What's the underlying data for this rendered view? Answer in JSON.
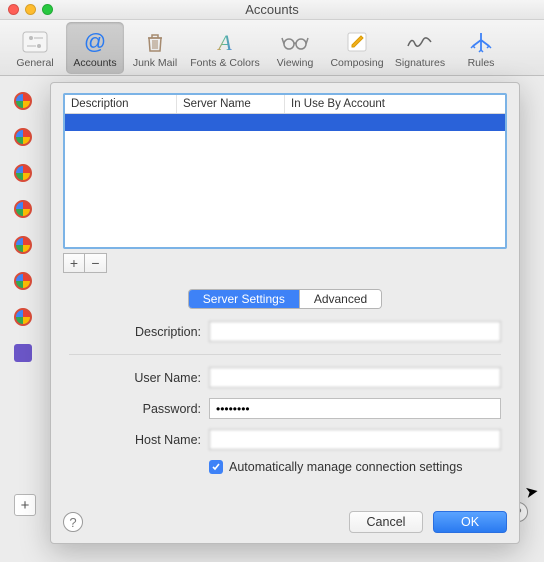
{
  "window": {
    "title": "Accounts"
  },
  "toolbar": {
    "items": [
      {
        "key": "general",
        "label": "General"
      },
      {
        "key": "accounts",
        "label": "Accounts"
      },
      {
        "key": "junk",
        "label": "Junk Mail"
      },
      {
        "key": "fonts",
        "label": "Fonts & Colors"
      },
      {
        "key": "viewing",
        "label": "Viewing"
      },
      {
        "key": "composing",
        "label": "Composing"
      },
      {
        "key": "signatures",
        "label": "Signatures"
      },
      {
        "key": "rules",
        "label": "Rules"
      }
    ],
    "selected": "accounts"
  },
  "sheet": {
    "table": {
      "columns": [
        "Description",
        "Server Name",
        "In Use By Account"
      ],
      "rows": [
        {
          "description": "",
          "server": "",
          "inuse": "",
          "selected": true
        }
      ]
    },
    "add_label": "+",
    "remove_label": "−",
    "tabs": {
      "server": "Server Settings",
      "advanced": "Advanced",
      "active": "server"
    },
    "form": {
      "description_label": "Description:",
      "description_value": "",
      "username_label": "User Name:",
      "username_value": "",
      "password_label": "Password:",
      "password_value": "••••••••",
      "hostname_label": "Host Name:",
      "hostname_value": "",
      "auto_label": "Automatically manage connection settings",
      "auto_checked": true
    },
    "buttons": {
      "cancel": "Cancel",
      "ok": "OK"
    },
    "help": "?"
  }
}
